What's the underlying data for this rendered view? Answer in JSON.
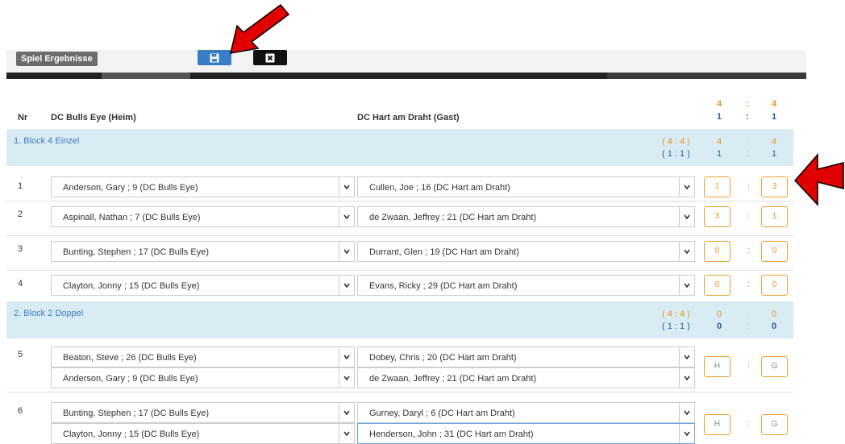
{
  "toolbar": {
    "tab_label": "Spiel Ergebnisse",
    "save_icon": "floppy-disk-icon",
    "close_icon": "close-x-icon"
  },
  "header": {
    "nr": "Nr",
    "home_team": "DC Bulls Eye (Heim)",
    "guest_team": "DC Hart am Draht (Gast)",
    "total_legs": {
      "home": "4",
      "sep": ":",
      "guest": "4"
    },
    "total_sets": {
      "home": "1",
      "sep": ":",
      "guest": "1"
    }
  },
  "blocks": [
    {
      "title": "1. Block 4 Einzel",
      "legs_label": "( 4 : 4 )",
      "sets_label": "( 1 : 1 )",
      "legs": {
        "home": "4",
        "sep": ":",
        "guest": "4"
      },
      "sets": {
        "home": "1",
        "sep": ":",
        "guest": "1"
      }
    },
    {
      "title": "2. Block 2 Doppel",
      "legs_label": "( 4 : 4 )",
      "sets_label": "( 1 : 1 )",
      "legs": {
        "home": "0",
        "sep": ":",
        "guest": "0"
      },
      "sets": {
        "home": "0",
        "sep": ":",
        "guest": "0"
      }
    }
  ],
  "games": [
    {
      "nr": "1",
      "home": "Anderson, Gary ; 9 (DC Bulls Eye)",
      "guest": "Cullen, Joe ; 16 (DC Hart am Draht)",
      "score_home": "1",
      "score_guest": "3"
    },
    {
      "nr": "2",
      "home": "Aspinall, Nathan ; 7 (DC Bulls Eye)",
      "guest": "de Zwaan, Jeffrey ; 21 (DC Hart am Draht)",
      "score_home": "3",
      "score_guest": "1"
    },
    {
      "nr": "3",
      "home": "Bunting, Stephen ; 17 (DC Bulls Eye)",
      "guest": "Durrant, Glen ; 19 (DC Hart am Draht)",
      "score_home": "0",
      "score_guest": "0"
    },
    {
      "nr": "4",
      "home": "Clayton, Jonny ; 15 (DC Bulls Eye)",
      "guest": "Evans, Ricky ; 29 (DC Hart am Draht)",
      "score_home": "0",
      "score_guest": "0"
    }
  ],
  "doubles": [
    {
      "nr": "5",
      "home1": "Beaton, Steve ; 26 (DC Bulls Eye)",
      "home2": "Anderson, Gary ; 9 (DC Bulls Eye)",
      "guest1": "Dobey, Chris ; 20 (DC Hart am Draht)",
      "guest2": "de Zwaan, Jeffrey ; 21 (DC Hart am Draht)",
      "score_home": "H",
      "score_guest": "G"
    },
    {
      "nr": "6",
      "home1": "Bunting, Stephen ; 17 (DC Bulls Eye)",
      "home2": "Clayton, Jonny ; 15 (DC Bulls Eye)",
      "guest1": "Gurney, Daryl ; 6 (DC Hart am Draht)",
      "guest2": "Henderson, John ; 31 (DC Hart am Draht)",
      "score_home": "H",
      "score_guest": "G"
    }
  ],
  "sep": ":",
  "colors": {
    "accent": "#f0901e",
    "blue": "#3a7cc5",
    "block_bg": "#d9ecf4",
    "arrow": "#e00000"
  }
}
